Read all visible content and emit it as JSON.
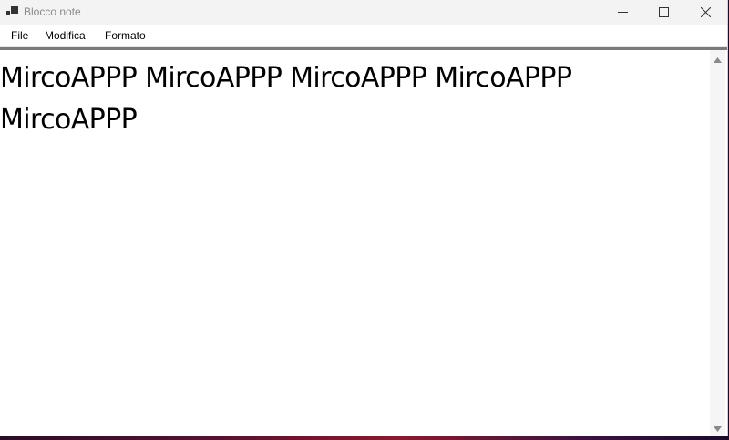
{
  "window": {
    "title": "Blocco note"
  },
  "menu": {
    "file": "File",
    "modifica": "Modifica",
    "formato": "Formato"
  },
  "editor": {
    "content": "MircoAPPP MircoAPPP MircoAPPP MircoAPPP MircoAPPP"
  },
  "icons": {
    "app": "notepad-app-icon",
    "minimize": "minimize-icon",
    "maximize": "maximize-icon",
    "close": "close-icon",
    "scroll_up": "scroll-up-arrow-icon",
    "scroll_down": "scroll-down-arrow-icon"
  }
}
